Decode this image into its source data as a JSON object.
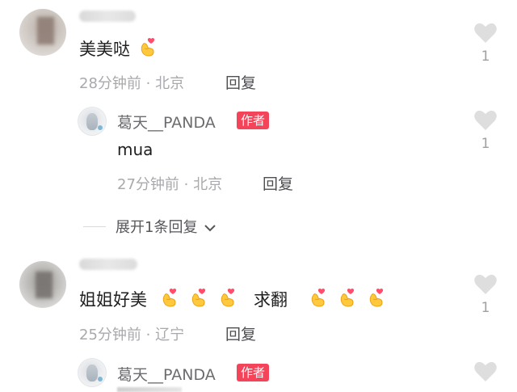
{
  "comments": [
    {
      "text": "美美哒",
      "emojis_after": 1,
      "meta": "28分钟前 · 北京",
      "reply_label": "回复",
      "likes": "1",
      "replies": [
        {
          "author": "葛天__PANDA",
          "badge": "作者",
          "text": "mua",
          "meta": "27分钟前 · 北京",
          "reply_label": "回复",
          "likes": "1"
        }
      ],
      "expand_label": "展开1条回复"
    },
    {
      "text_before": "姐姐好美",
      "text_after": "求翻",
      "meta": "25分钟前 · 辽宁",
      "reply_label": "回复",
      "likes": "1",
      "replies": [
        {
          "author": "葛天__PANDA",
          "badge": "作者",
          "likes": ""
        }
      ]
    }
  ],
  "icons": {
    "like": "heart-icon",
    "emoji": "finger-heart-emoji",
    "expand": "chevron-down-icon"
  },
  "colors": {
    "badge": "#f4445a",
    "like_icon": "#dedede",
    "meta_text": "#a9a9ad"
  }
}
